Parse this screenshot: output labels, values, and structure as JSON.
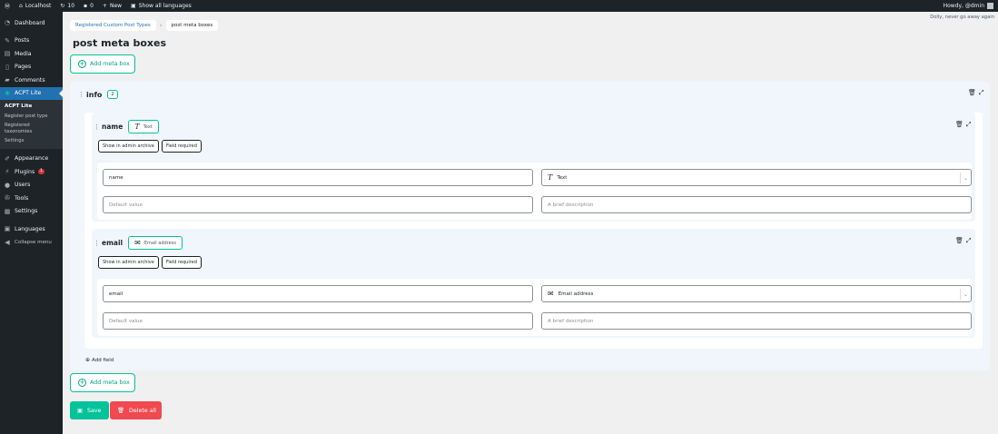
{
  "adminbar": {
    "site_name": "Localhost",
    "updates_count": "10",
    "comments_count": "0",
    "new_label": "New",
    "languages_label": "Show all languages",
    "howdy": "Howdy, @dmin"
  },
  "sidebar": {
    "dashboard": "Dashboard",
    "posts": "Posts",
    "media": "Media",
    "pages": "Pages",
    "comments": "Comments",
    "acpt": "ACPT Lite",
    "sub": {
      "acpt": "ACPT Lite",
      "register": "Register post type",
      "registered_tax": "Registered taxonomies",
      "settings": "Settings"
    },
    "appearance": "Appearance",
    "plugins": "Plugins",
    "plugins_badge": "1",
    "users": "Users",
    "tools": "Tools",
    "settings": "Settings",
    "languages": "Languages",
    "collapse": "Collapse menu"
  },
  "main": {
    "dolly": "Dolly, never go away again",
    "breadcrumb": {
      "parent": "Registered Custom Post Types",
      "current": "post meta boxes"
    },
    "title": "post meta boxes",
    "add_meta_box": "Add meta box",
    "box": {
      "name": "info",
      "count": "2",
      "fields": [
        {
          "name": "name",
          "type_label": "Text",
          "chip_archive": "Show in admin archive",
          "chip_required": "Field required",
          "name_value": "name",
          "type_value": "Text",
          "default_placeholder": "Default value",
          "desc_placeholder": "A brief description"
        },
        {
          "name": "email",
          "type_label": "Email address",
          "chip_archive": "Show in admin archive",
          "chip_required": "Field required",
          "name_value": "email",
          "type_value": "Email address",
          "default_placeholder": "Default value",
          "desc_placeholder": "A brief description"
        }
      ]
    },
    "add_field": "Add field",
    "save": "Save",
    "delete_all": "Delete all"
  },
  "colors": {
    "accent": "#02c39a",
    "danger": "#f0494f",
    "wp_blue": "#2271b1"
  }
}
